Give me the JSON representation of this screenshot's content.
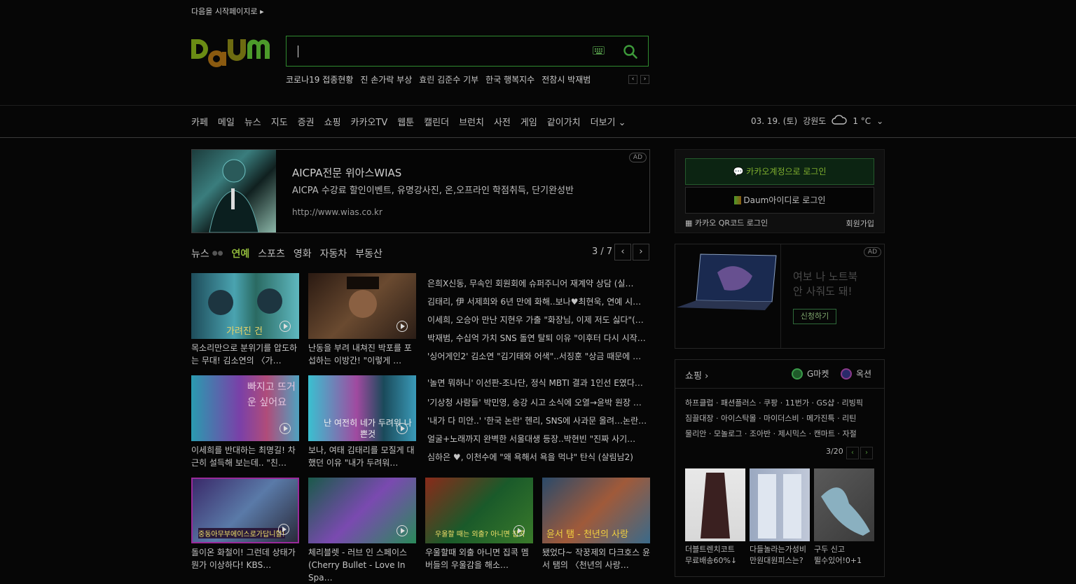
{
  "top": {
    "set_start": "다음을 시작페이지로 ▸"
  },
  "search": {
    "placeholder": "",
    "value": ""
  },
  "trending": [
    "코로나19 접종현황",
    "진 손가락 부상",
    "효린 김준수 기부",
    "한국 행복지수",
    "전참시 박재범"
  ],
  "gnb": {
    "items": [
      "카페",
      "메일",
      "뉴스",
      "지도",
      "증권",
      "쇼핑",
      "카카오TV",
      "웹툰",
      "캘린더",
      "브런치",
      "사전",
      "게임",
      "같이가치",
      "더보기"
    ],
    "date": "03. 19. (토)",
    "region": "강원도",
    "temp": "1 °C"
  },
  "ad_banner": {
    "title": "AICPA전문 위아스WIAS",
    "desc": "AICPA 수강료 할인이벤트, 유명강사진, 온,오프라인 학점취득, 단기완성반",
    "url": "http://www.wias.co.kr",
    "tag": "AD"
  },
  "news": {
    "tabs": [
      "뉴스",
      "연예",
      "스포츠",
      "영화",
      "자동차",
      "부동산"
    ],
    "page": "3 / 7",
    "row1": [
      {
        "caption": "목소리만으로 분위기를 압도하는 무대! 김소연의 〈가…"
      },
      {
        "caption": "난동을 부려 내쳐진 박포를 포섭하는 이방간! \"이렇게 …"
      }
    ],
    "row2": [
      {
        "caption": "이세희를 반대하는 최명길! 차근히 설득해 보는데.. \"친…"
      },
      {
        "caption": "보나, 여태 김태리를 모질게 대했던 이유 \"내가 두려워…"
      }
    ],
    "headlines_a": [
      "은희X신동, 무속인 회원회에 슈퍼주니어 재계약 상담 (실…",
      "김태리, 伊 서제희와 6년 만에 화해..보나♥최현욱, 연예 시…",
      "이세희, 오승아 만난 지현우 가출 \"화장님, 이제 저도 싫다\"(…",
      "박재범, 수십억 가치 SNS 돌연 탈퇴 이유 \"이후터 다시 시작…",
      "'싱어게인2' 김소연 \"김기태와 어색\"..서징훈 \"상금 때문에 …"
    ],
    "headlines_b": [
      "'놀면 뭐하니' 이선판-조나단, 정식 MBTI 결과 1인선 E였다…",
      "'기상청 사람들' 박민영, 송강 시고 소식에 오열→윤박 원장 …",
      "'내가 다 미안..' '한국 논란' 헨리, SNS에 사과문 올려…논란…",
      "얼굴+노래까지 완벽한 서울대생 등장..박현빈 \"진짜 사기…",
      "심하은 ♥, 이천수에 \"왜 욕해서 욕을 먹냐\" 탄식 (살림남2)"
    ],
    "row3": [
      {
        "caption": "돌이온 화철이! 그런데 상태가 뭔가 이상하다! KBS…"
      },
      {
        "caption": "체리블렛 - 러브 인 스페이스 (Cherry Bullet - Love In Spa…"
      },
      {
        "caption": "우울할때 외출 아니면 집콕 멤버들의 우울감을 해소…"
      },
      {
        "caption": "됐었다~ 작꿍제외 다크호스 윤서 탬의 〈천년의 사랑…"
      }
    ],
    "thumb_texts": {
      "t1": "가려진 건",
      "t3": "빠지고 뜨거운 싶어요",
      "t4": "난 여전히 네가 두려워 나쁜것",
      "t5": "중동아무부에이스로가답니할!",
      "t7": "우울할 때는 외출? 아니면 집콕",
      "t8": "윤서 탬 - 천년의 사랑"
    }
  },
  "login": {
    "kakao": "카카오계정으로 로그인",
    "daum": "Daum아이디로 로그인",
    "qr": "카카오 QR코드 로그인",
    "signup": "회원가입"
  },
  "laptop_ad": {
    "line1": "여보 나 노트북",
    "line2": "안 사줘도 돼!",
    "button": "신청하기",
    "tag": "AD"
  },
  "shopping": {
    "title": "쇼핑",
    "gmarket": "G마켓",
    "auction": "옥션",
    "rows": [
      "하프클럽 · 패션플러스 · 쿠팡 · 11번가 · GS샵 · 리빙픽",
      "짐끌대장 · 아이스탁몰 · 마이더스비 · 메가진특 · 리틴",
      "물리안 · 모놀로그 · 조아반 · 제시믹스 · 캔마트 · 자절"
    ],
    "page": "3/20",
    "products": [
      {
        "caption_1": "더블트렌치코트",
        "caption_2": "무료배송60%↓"
      },
      {
        "caption_1": "다들놀라는가성비",
        "caption_2": "만원대원피스는?"
      },
      {
        "caption_1": "구두 신고",
        "caption_2": "뛸수있어!0+1"
      }
    ]
  },
  "colors": {
    "accent_green": "#8fb73a",
    "background": "#060606",
    "logo_green": "#4c9a2a",
    "logo_olive": "#6d6b11",
    "logo_brown": "#8a5a10"
  }
}
